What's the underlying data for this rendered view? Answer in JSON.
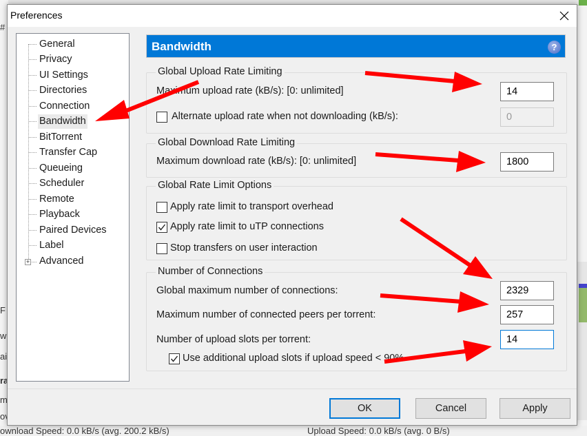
{
  "background": {
    "left_fragments": [
      "#",
      "F",
      "w",
      "ai",
      "ra",
      "m",
      "ov"
    ],
    "status_bar": {
      "download": "ownload Speed:   0.0 kB/s (avg. 200.2 kB/s)",
      "upload": "Upload Speed:   0.0 kB/s (avg. 0 B/s)"
    }
  },
  "window": {
    "title": "Preferences",
    "close_icon": "close-icon"
  },
  "tree": {
    "items": [
      {
        "label": "General"
      },
      {
        "label": "Privacy"
      },
      {
        "label": "UI Settings"
      },
      {
        "label": "Directories"
      },
      {
        "label": "Connection"
      },
      {
        "label": "Bandwidth",
        "selected": true
      },
      {
        "label": "BitTorrent"
      },
      {
        "label": "Transfer Cap"
      },
      {
        "label": "Queueing"
      },
      {
        "label": "Scheduler"
      },
      {
        "label": "Remote"
      },
      {
        "label": "Playback"
      },
      {
        "label": "Paired Devices"
      },
      {
        "label": "Label"
      },
      {
        "label": "Advanced",
        "expandable": true
      }
    ]
  },
  "panel": {
    "title": "Bandwidth",
    "help_icon": "help-icon",
    "accent": "#0078d7",
    "upload_group": {
      "label": "Global Upload Rate Limiting",
      "max_upload_label": "Maximum upload rate (kB/s): [0: unlimited]",
      "max_upload_value": "14",
      "alternate_label": "Alternate upload rate when not downloading (kB/s):",
      "alternate_checked": false,
      "alternate_value": "0"
    },
    "download_group": {
      "label": "Global Download Rate Limiting",
      "max_download_label": "Maximum download rate (kB/s): [0: unlimited]",
      "max_download_value": "1800"
    },
    "options_group": {
      "label": "Global Rate Limit Options",
      "transport_overhead_label": "Apply rate limit to transport overhead",
      "transport_overhead_checked": false,
      "utp_label": "Apply rate limit to uTP connections",
      "utp_checked": true,
      "stop_transfers_label": "Stop transfers on user interaction",
      "stop_transfers_checked": false
    },
    "connections_group": {
      "label": "Number of Connections",
      "global_max_label": "Global maximum number of connections:",
      "global_max_value": "2329",
      "peers_label": "Maximum number of connected peers per torrent:",
      "peers_value": "257",
      "slots_label": "Number of upload slots per torrent:",
      "slots_value": "14",
      "additional_slots_label": "Use additional upload slots if upload speed < 90%",
      "additional_slots_checked": true
    }
  },
  "buttons": {
    "ok": "OK",
    "cancel": "Cancel",
    "apply": "Apply"
  },
  "annotation": {
    "arrow_color": "#ff0000"
  }
}
